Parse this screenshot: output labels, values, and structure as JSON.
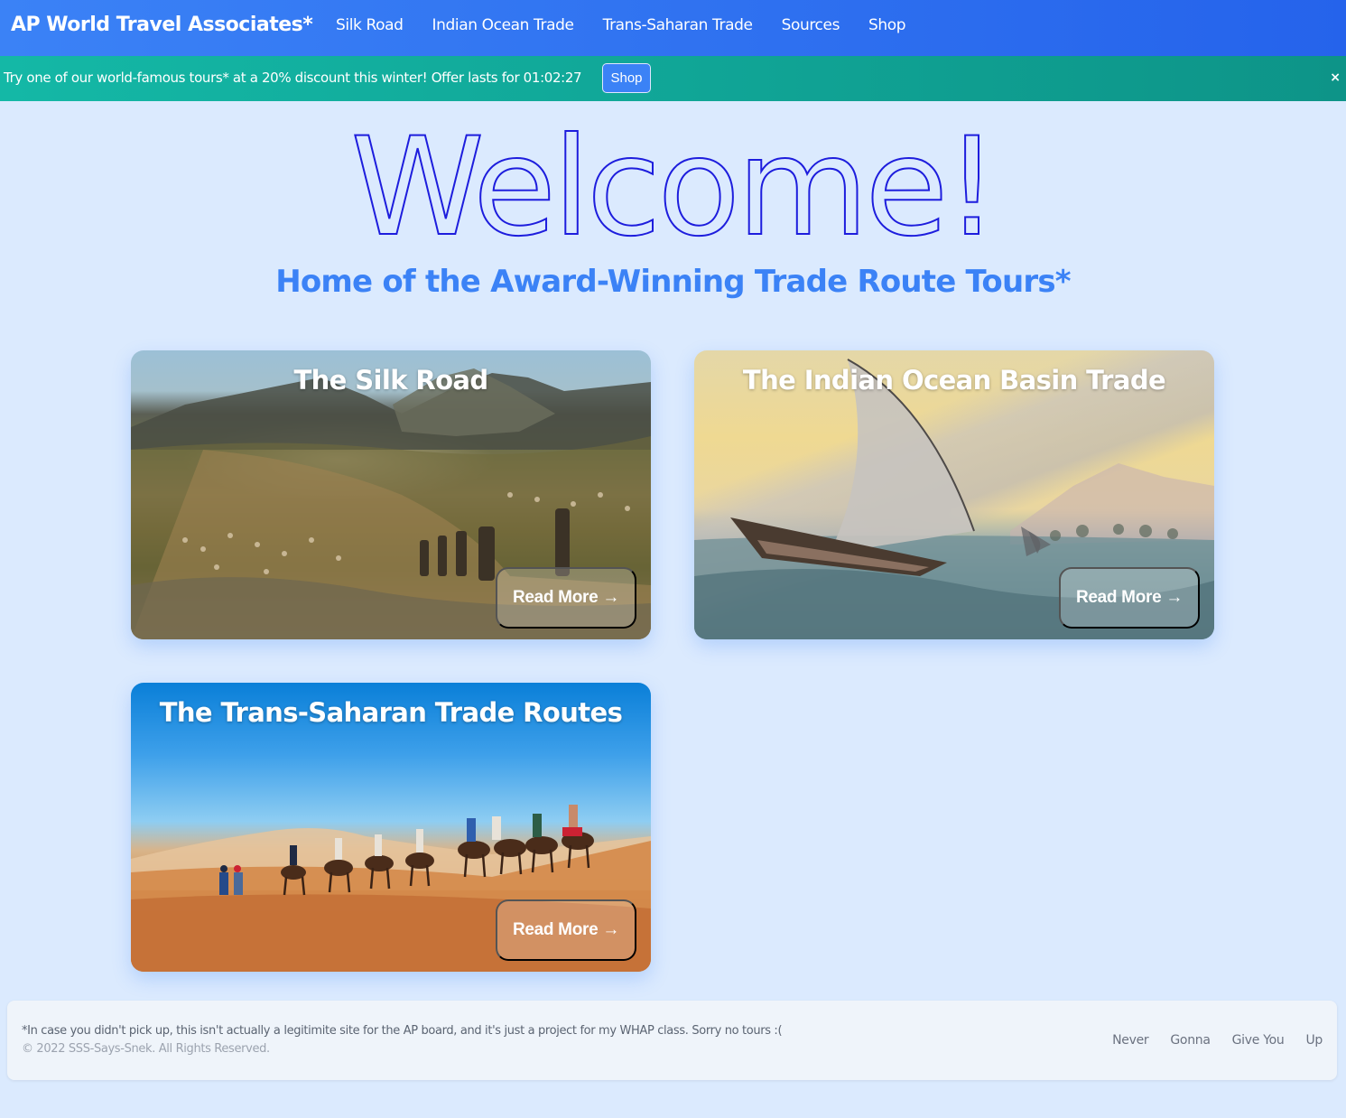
{
  "navbar": {
    "brand": "AP World Travel Associates*",
    "links": [
      "Silk Road",
      "Indian Ocean Trade",
      "Trans-Saharan Trade",
      "Sources",
      "Shop"
    ]
  },
  "banner": {
    "text": "Try one of our world-famous tours* at a 20% discount this winter! Offer lasts for 01:02:27",
    "shop_label": "Shop",
    "close_label": "×"
  },
  "hero": {
    "title": "Welcome!",
    "subtitle": "Home of the Award-Winning Trade Route Tours*"
  },
  "cards": [
    {
      "title": "The Silk Road",
      "read_more": "Read More →",
      "image": "caravan-mountains-photo"
    },
    {
      "title": "The Indian Ocean Basin Trade",
      "read_more": "Read More →",
      "image": "dhow-sailboat-painting"
    },
    {
      "title": "The Trans-Saharan Trade Routes",
      "read_more": "Read More →",
      "image": "camel-caravan-desert-photo"
    }
  ],
  "footer": {
    "note": "*In case you didn't pick up, this isn't actually a legitimite site for the AP board, and it's just a project for my WHAP class. Sorry no tours :(",
    "copyright": "© 2022 SSS-Says-Snek. All Rights Reserved.",
    "links": [
      "Never",
      "Gonna",
      "Give You",
      "Up"
    ]
  },
  "colors": {
    "navbar": "#3b82f6",
    "banner": "#14b8a6",
    "welcome_outline": "#1d1ddd",
    "subtitle": "#3b82f6",
    "page_bg": "#dbeafe"
  }
}
